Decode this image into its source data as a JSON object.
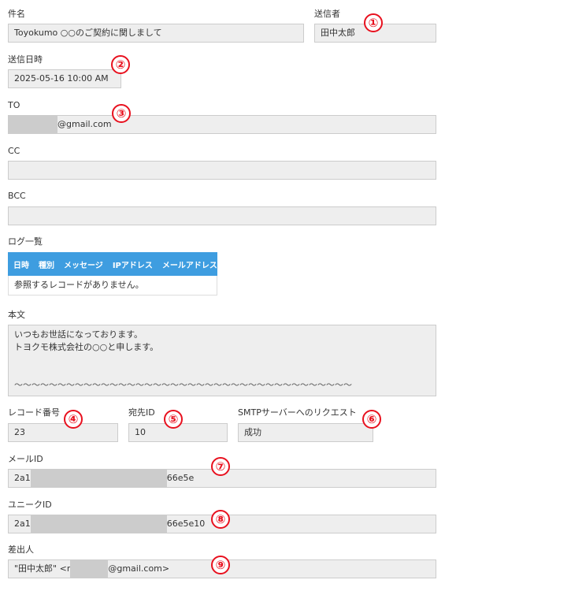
{
  "subject": {
    "label": "件名",
    "value": "Toyokumo ○○のご契約に関しまして"
  },
  "sender": {
    "label": "送信者",
    "value": "田中太郎"
  },
  "sent_at": {
    "label": "送信日時",
    "value": "2025-05-16 10:00 AM"
  },
  "to": {
    "label": "TO",
    "value_suffix": "@gmail.com"
  },
  "cc": {
    "label": "CC",
    "value": ""
  },
  "bcc": {
    "label": "BCC",
    "value": ""
  },
  "log": {
    "label": "ログ一覧",
    "columns": [
      "日時",
      "種別",
      "メッセージ",
      "IPアドレス",
      "メールアドレス"
    ],
    "empty_text": "参照するレコードがありません。"
  },
  "body": {
    "label": "本文",
    "lines": [
      "いつもお世話になっております。",
      "トヨクモ株式会社の○○と申します。",
      "",
      "",
      "～～～～～～～～～～～～～～～～～～～～～～～～～～～～～～～～～～～～～～～"
    ]
  },
  "record_number": {
    "label": "レコード番号",
    "value": "23"
  },
  "destination_id": {
    "label": "宛先ID",
    "value": "10"
  },
  "smtp_request": {
    "label": "SMTPサーバーへのリクエスト",
    "value": "成功"
  },
  "mail_id": {
    "label": "メールID",
    "prefix": "2a1",
    "suffix": "66e5e"
  },
  "unique_id": {
    "label": "ユニークID",
    "prefix": "2a1",
    "suffix": "66e5e10"
  },
  "from": {
    "label": "差出人",
    "prefix": "\"田中太郎\" <r",
    "suffix": "@gmail.com>"
  },
  "annotations": [
    "①",
    "②",
    "③",
    "④",
    "⑤",
    "⑥",
    "⑦",
    "⑧",
    "⑨"
  ],
  "colors": {
    "accent": "#3e9de0",
    "annotation": "#e8101e",
    "field_bg": "#eeeeee"
  }
}
